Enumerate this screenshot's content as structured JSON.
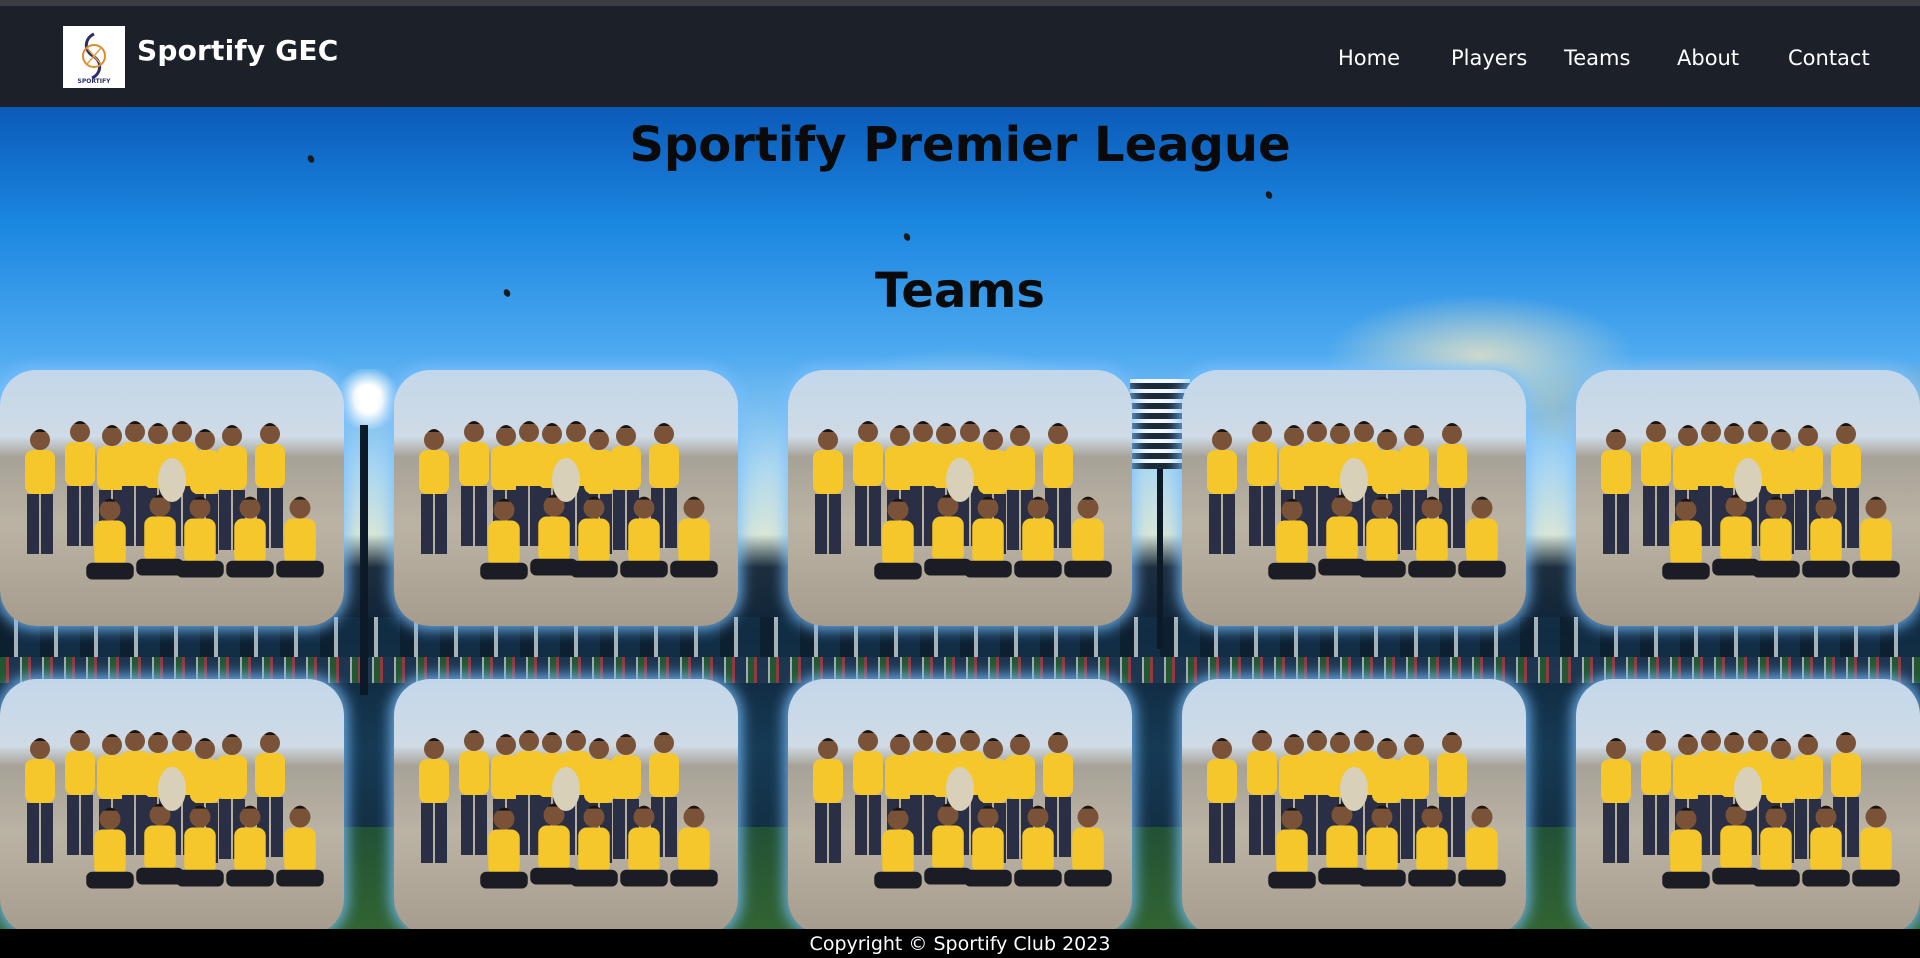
{
  "navbar": {
    "brand": "Sportify GEC",
    "logo_text": "SPORTIFY",
    "links": [
      "Home",
      "Players",
      "Teams",
      "About",
      "Contact"
    ]
  },
  "hero": {
    "title": "Sportify Premier League",
    "subtitle": "Teams"
  },
  "team_cards": {
    "count": 10,
    "image": "team-group-photo"
  },
  "footer": {
    "text": "Copyright © Sportify Club 2023"
  },
  "colors": {
    "navbar_bg": "#1b2029",
    "card_glow": "#78beff",
    "jersey": "#f5c72a",
    "footer_bg": "#000000"
  }
}
